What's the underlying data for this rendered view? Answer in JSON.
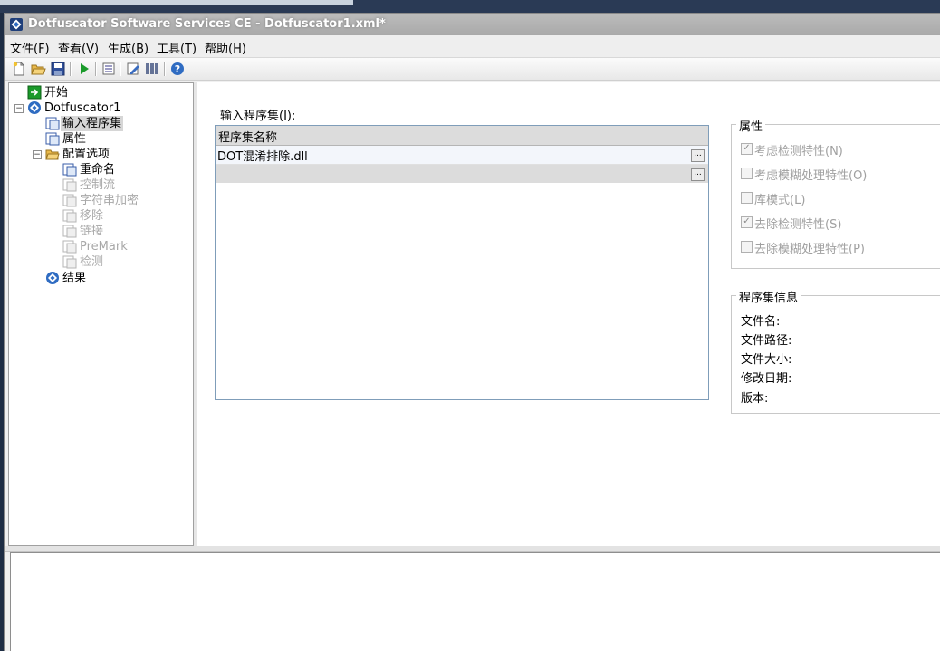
{
  "window": {
    "title": "Dotfuscator Software Services CE - Dotfuscator1.xml*"
  },
  "menu": {
    "items": [
      "文件(F)",
      "查看(V)",
      "生成(B)",
      "工具(T)",
      "帮助(H)"
    ]
  },
  "toolbar": {
    "buttons": [
      "new-file-icon",
      "open-folder-icon",
      "save-icon",
      "run-icon",
      "list-icon",
      "edit-icon",
      "barcode-icon",
      "help-icon"
    ]
  },
  "tree": {
    "start": "开始",
    "project": "Dotfuscator1",
    "input_assemblies": "输入程序集",
    "properties": "属性",
    "config_options": "配置选项",
    "rename": "重命名",
    "control_flow": "控制流",
    "string_encryption": "字符串加密",
    "removal": "移除",
    "linking": "链接",
    "premark": "PreMark",
    "detection": "检测",
    "results": "结果"
  },
  "input_assemblies": {
    "label": "输入程序集(I):",
    "column_header": "程序集名称",
    "rows": [
      "DOT混淆排除.dll",
      ""
    ]
  },
  "properties_group": {
    "title": "属性",
    "items": [
      {
        "label": "考虑检测特性(N)",
        "checked": true
      },
      {
        "label": "考虑模糊处理特性(O)",
        "checked": false
      },
      {
        "label": "库模式(L)",
        "checked": false
      },
      {
        "label": "去除检测特性(S)",
        "checked": true
      },
      {
        "label": "去除模糊处理特性(P)",
        "checked": false
      }
    ]
  },
  "assembly_info": {
    "title": "程序集信息",
    "file_name": "文件名:",
    "file_path": "文件路径:",
    "file_size": "文件大小:",
    "modified_date": "修改日期:",
    "version": "版本:"
  },
  "colors": {
    "titlebar": "#b2b2b2",
    "selection": "#d6d6d6",
    "grid_border": "#7f9db9"
  }
}
